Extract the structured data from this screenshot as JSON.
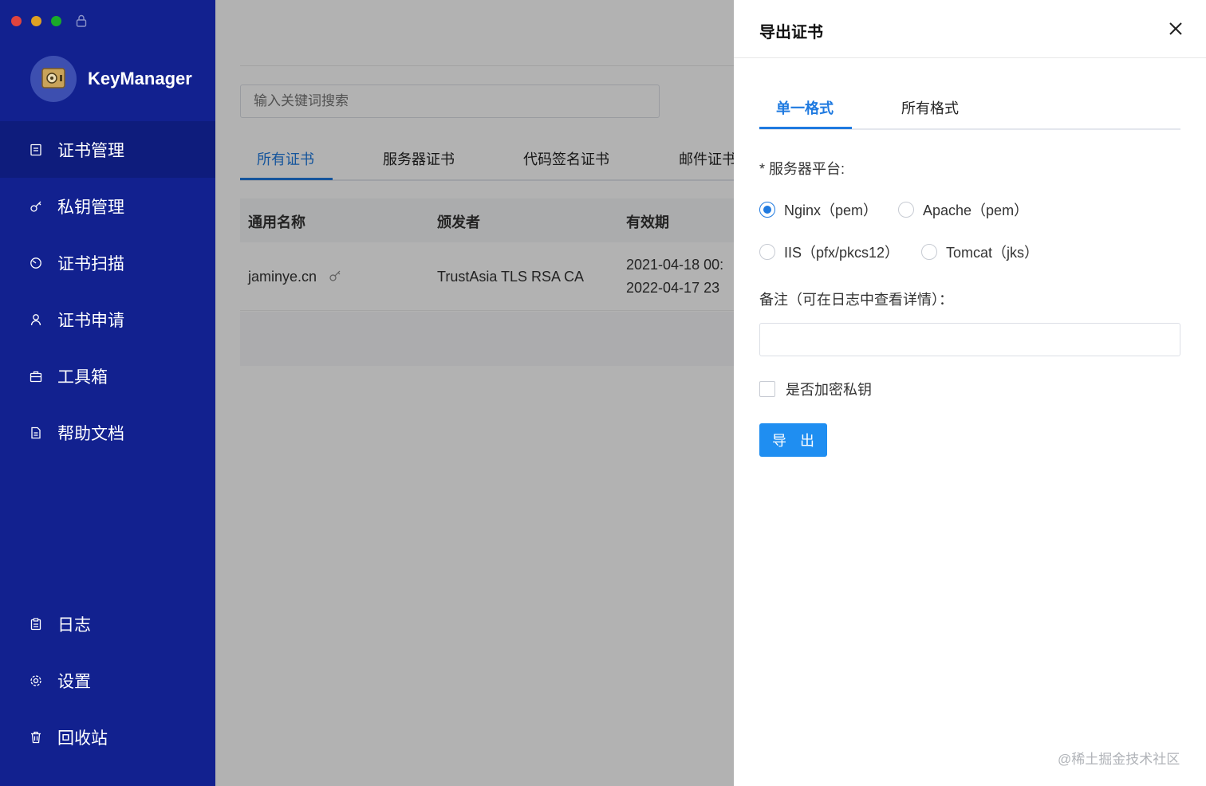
{
  "app": {
    "name": "KeyManager"
  },
  "sidebar": {
    "items": [
      {
        "label": "证书管理",
        "icon": "certificate-icon"
      },
      {
        "label": "私钥管理",
        "icon": "key-icon"
      },
      {
        "label": "证书扫描",
        "icon": "scan-icon"
      },
      {
        "label": "证书申请",
        "icon": "user-icon"
      },
      {
        "label": "工具箱",
        "icon": "toolbox-icon"
      },
      {
        "label": "帮助文档",
        "icon": "document-icon"
      }
    ],
    "bottom_items": [
      {
        "label": "日志",
        "icon": "clipboard-icon"
      },
      {
        "label": "设置",
        "icon": "gear-icon"
      },
      {
        "label": "回收站",
        "icon": "trash-icon"
      }
    ]
  },
  "main": {
    "search_placeholder": "输入关键词搜索",
    "tabs": [
      "所有证书",
      "服务器证书",
      "代码签名证书",
      "邮件证书"
    ],
    "table": {
      "columns": [
        "通用名称",
        "颁发者",
        "有效期"
      ],
      "rows": [
        {
          "common_name": "jaminye.cn",
          "issuer": "TrustAsia TLS RSA CA",
          "valid_from": "2021-04-18 00:",
          "valid_to": "2022-04-17 23"
        }
      ]
    }
  },
  "drawer": {
    "title": "导出证书",
    "tabs": [
      "单一格式",
      "所有格式"
    ],
    "platform_label": "* 服务器平台:",
    "platforms": [
      "Nginx（pem）",
      "Apache（pem）",
      "IIS（pfx/pkcs12）",
      "Tomcat（jks）"
    ],
    "selected_platform": "Nginx（pem）",
    "note_label": "备注（可在日志中查看详情）：",
    "note_value": "",
    "encrypt_label": "是否加密私钥",
    "encrypt_checked": false,
    "export_label": "导 出"
  },
  "watermark": "@稀土掘金技术社区",
  "colors": {
    "sidebar": "#12218f",
    "accent": "#1f7ae0",
    "button": "#1f8ef1"
  }
}
